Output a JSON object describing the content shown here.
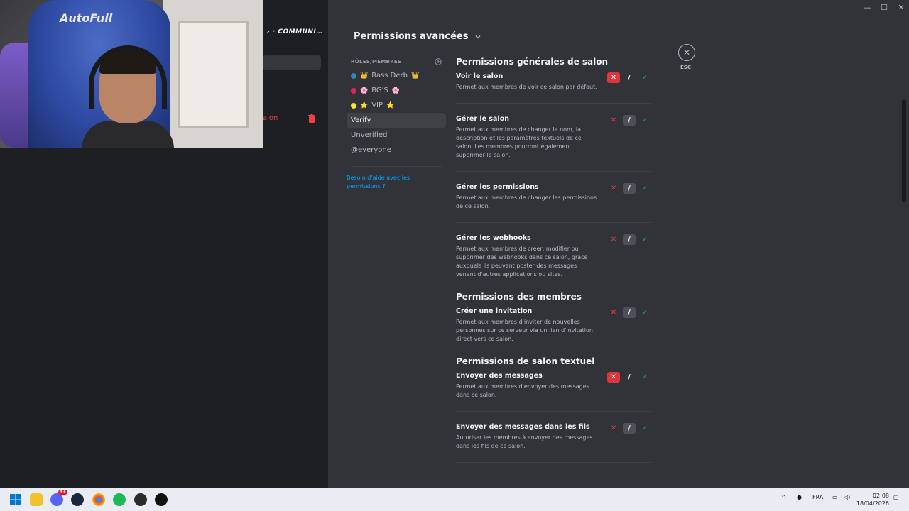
{
  "left_pane": {
    "header": "› · COMMUNI…",
    "danger_item": "alon"
  },
  "webcam": {
    "brand": "AutoFull"
  },
  "window": {
    "minimize": "—",
    "maximize": "☐",
    "close": "✕"
  },
  "modal": {
    "title": "Permissions avancées",
    "close_label": "ESC",
    "roles_header": "RÔLES/MEMBRES",
    "roles": [
      {
        "label": "Rass Derb",
        "dot_color": "#2f8ab3",
        "emoji": "👑"
      },
      {
        "label": "BG'S",
        "dot_color": "#e0245e",
        "emoji": "🌸"
      },
      {
        "label": "VIP",
        "dot_color": "#f0e62a",
        "emoji": "⭐"
      },
      {
        "label": "Verify",
        "selected": true
      },
      {
        "label": "Unverified"
      },
      {
        "label": "@everyone"
      }
    ],
    "help_link": "Besoin d'aide avec les permissions ?"
  },
  "sections": [
    {
      "title": "Permissions générales de salon",
      "perms": [
        {
          "name": "Voir le salon",
          "desc": "Permet aux membres de voir ce salon par défaut.",
          "state": "deny"
        },
        {
          "name": "Gérer le salon",
          "desc": "Permet aux membres de changer le nom, la description et les paramètres textuels de ce salon. Les membres pourront également supprimer le salon.",
          "state": "neutral"
        },
        {
          "name": "Gérer les permissions",
          "desc": "Permet aux membres de changer les permissions de ce salon.",
          "state": "neutral"
        },
        {
          "name": "Gérer les webhooks",
          "desc": "Permet aux membres de créer, modifier ou supprimer des webhooks dans ce salon, grâce auxquels ils peuvent poster des messages venant d'autres applications ou sites.",
          "state": "neutral"
        }
      ]
    },
    {
      "title": "Permissions des membres",
      "perms": [
        {
          "name": "Créer une invitation",
          "desc": "Permet aux membres d'inviter de nouvelles personnes sur ce serveur via un lien d'invitation direct vers ce salon.",
          "state": "neutral"
        }
      ]
    },
    {
      "title": "Permissions de salon textuel",
      "perms": [
        {
          "name": "Envoyer des messages",
          "desc": "Permet aux membres d'envoyer des messages dans ce salon.",
          "state": "deny"
        },
        {
          "name": "Envoyer des messages dans les fils",
          "desc": "Autoriser les membres à envoyer des messages dans les fils de ce salon.",
          "state": "neutral"
        }
      ]
    }
  ],
  "toggle_glyphs": {
    "deny": "✕",
    "neutral": "/",
    "allow": "✓"
  },
  "taskbar": {
    "badge": "9+",
    "language": "FRA",
    "time": "02:08",
    "date": "18/04/2026"
  },
  "colors": {
    "deny_active": "#da373c",
    "allow": "#23a55a",
    "link": "#00a8fc"
  }
}
